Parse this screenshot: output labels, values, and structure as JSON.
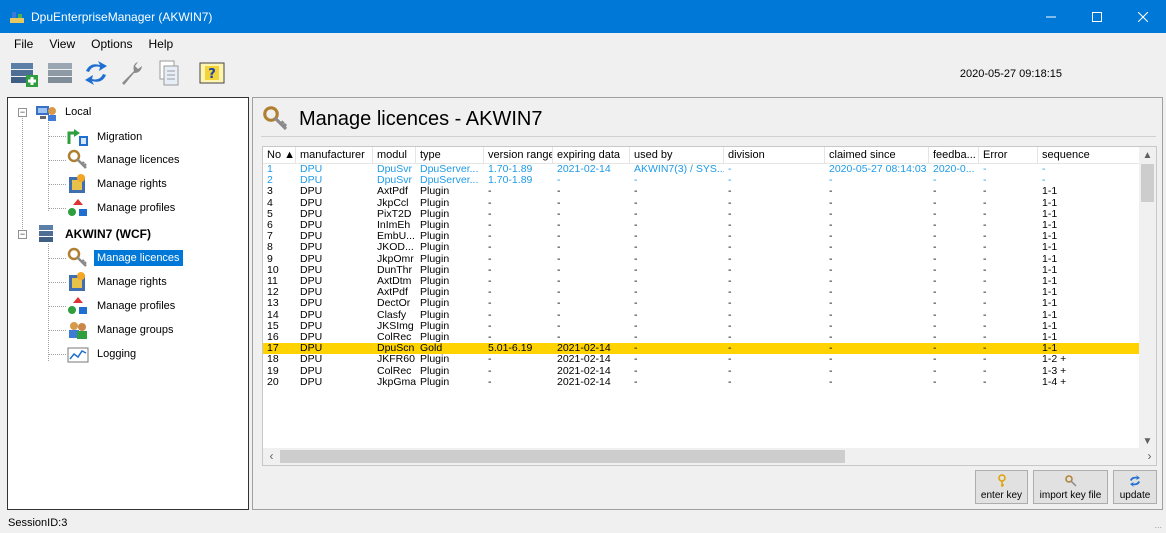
{
  "window": {
    "title": "DpuEnterpriseManager (AKWIN7)",
    "accent": "#0078d7"
  },
  "menu": [
    "File",
    "View",
    "Options",
    "Help"
  ],
  "toolbar": {
    "datetime": "2020-05-27 09:18:15",
    "icons": [
      "add-server-icon",
      "server-icon",
      "refresh-icon",
      "wrench-icon",
      "document-icon",
      "help-icon"
    ]
  },
  "tree": {
    "local": {
      "label": "Local",
      "items": [
        "Migration",
        "Manage licences",
        "Manage rights",
        "Manage profiles"
      ]
    },
    "server": {
      "label": "AKWIN7 (WCF)",
      "items": [
        "Manage licences",
        "Manage rights",
        "Manage profiles",
        "Manage groups",
        "Logging"
      ],
      "selected_index": 0
    }
  },
  "main": {
    "heading": "Manage licences - AKWIN7",
    "columns": [
      "No ▲",
      "manufacturer",
      "modul",
      "type",
      "version range",
      "expiring data",
      "used by",
      "division",
      "claimed since",
      "feedba...",
      "Error",
      "sequence"
    ],
    "rows": [
      [
        "1",
        "DPU",
        "DpuSvr",
        "DpuServer...",
        "1.70-1.89",
        "2021-02-14",
        "AKWIN7(3) / SYS...",
        "-",
        "2020-05-27 08:14:03",
        "2020-0...",
        "-",
        "-"
      ],
      [
        "2",
        "DPU",
        "DpuSvr",
        "DpuServer...",
        "1.70-1.89",
        "-",
        "-",
        "-",
        "-",
        "-",
        "-",
        "-"
      ],
      [
        "3",
        "DPU",
        "AxtPdf",
        "Plugin",
        "-",
        "-",
        "-",
        "-",
        "-",
        "-",
        "-",
        "1-1"
      ],
      [
        "4",
        "DPU",
        "JkpCcl",
        "Plugin",
        "-",
        "-",
        "-",
        "-",
        "-",
        "-",
        "-",
        "1-1"
      ],
      [
        "5",
        "DPU",
        "PixT2D",
        "Plugin",
        "-",
        "-",
        "-",
        "-",
        "-",
        "-",
        "-",
        "1-1"
      ],
      [
        "6",
        "DPU",
        "InImEh",
        "Plugin",
        "-",
        "-",
        "-",
        "-",
        "-",
        "-",
        "-",
        "1-1"
      ],
      [
        "7",
        "DPU",
        "EmbU...",
        "Plugin",
        "-",
        "-",
        "-",
        "-",
        "-",
        "-",
        "-",
        "1-1"
      ],
      [
        "8",
        "DPU",
        "JKOD...",
        "Plugin",
        "-",
        "-",
        "-",
        "-",
        "-",
        "-",
        "-",
        "1-1"
      ],
      [
        "9",
        "DPU",
        "JkpOmr",
        "Plugin",
        "-",
        "-",
        "-",
        "-",
        "-",
        "-",
        "-",
        "1-1"
      ],
      [
        "10",
        "DPU",
        "DunThr",
        "Plugin",
        "-",
        "-",
        "-",
        "-",
        "-",
        "-",
        "-",
        "1-1"
      ],
      [
        "11",
        "DPU",
        "AxtDtm",
        "Plugin",
        "-",
        "-",
        "-",
        "-",
        "-",
        "-",
        "-",
        "1-1"
      ],
      [
        "12",
        "DPU",
        "AxtPdf",
        "Plugin",
        "-",
        "-",
        "-",
        "-",
        "-",
        "-",
        "-",
        "1-1"
      ],
      [
        "13",
        "DPU",
        "DectOr",
        "Plugin",
        "-",
        "-",
        "-",
        "-",
        "-",
        "-",
        "-",
        "1-1"
      ],
      [
        "14",
        "DPU",
        "Clasfy",
        "Plugin",
        "-",
        "-",
        "-",
        "-",
        "-",
        "-",
        "-",
        "1-1"
      ],
      [
        "15",
        "DPU",
        "JKSImg",
        "Plugin",
        "-",
        "-",
        "-",
        "-",
        "-",
        "-",
        "-",
        "1-1"
      ],
      [
        "16",
        "DPU",
        "ColRec",
        "Plugin",
        "-",
        "-",
        "-",
        "-",
        "-",
        "-",
        "-",
        "1-1"
      ],
      [
        "17",
        "DPU",
        "DpuScn",
        "Gold",
        "5.01-6.19",
        "2021-02-14",
        "-",
        "-",
        "-",
        "-",
        "-",
        "1-1"
      ],
      [
        "18",
        "DPU",
        "JKFR60",
        "Plugin",
        "-",
        "2021-02-14",
        "-",
        "-",
        "-",
        "-",
        "-",
        "1-2 +"
      ],
      [
        "19",
        "DPU",
        "ColRec",
        "Plugin",
        "-",
        "2021-02-14",
        "-",
        "-",
        "-",
        "-",
        "-",
        "1-3 +"
      ],
      [
        "20",
        "DPU",
        "JkpGma",
        "Plugin",
        "-",
        "2021-02-14",
        "-",
        "-",
        "-",
        "-",
        "-",
        "1-4 +"
      ]
    ],
    "blue_rows": [
      0,
      1
    ],
    "selected_row": 16,
    "row_colors": {
      "blue": "#1e9be8",
      "selected": "#ffd300"
    },
    "buttons": {
      "enter_key": "enter key",
      "import_key_file": "import key file",
      "update": "update"
    }
  },
  "status": {
    "session": "SessionID:3",
    "grip": "..."
  }
}
